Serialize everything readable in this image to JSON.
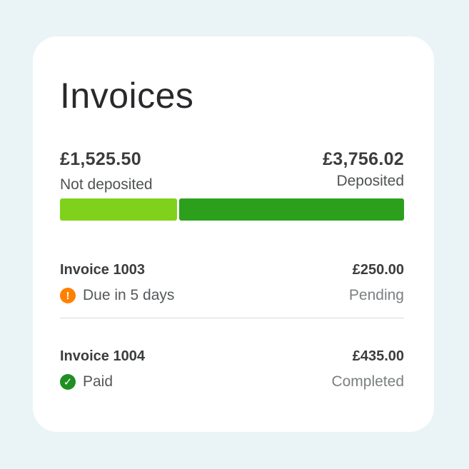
{
  "header": {
    "title": "Invoices"
  },
  "summary": {
    "not_deposited": {
      "amount": "£1,525.50",
      "label": "Not deposited"
    },
    "deposited": {
      "amount": "£3,756.02",
      "label": "Deposited"
    },
    "not_deposited_fraction": 0.34
  },
  "colors": {
    "not_deposited_bar": "#7fd11b",
    "deposited_bar": "#2ca01c",
    "pending_icon": "#ff8000",
    "completed_icon": "#1f8f21"
  },
  "invoices": [
    {
      "name": "Invoice 1003",
      "amount": "£250.00",
      "status_text": "Due in 5 days",
      "status_icon": "warning-icon",
      "state": "Pending"
    },
    {
      "name": "Invoice 1004",
      "amount": "£435.00",
      "status_text": "Paid",
      "status_icon": "check-icon",
      "state": "Completed"
    }
  ]
}
